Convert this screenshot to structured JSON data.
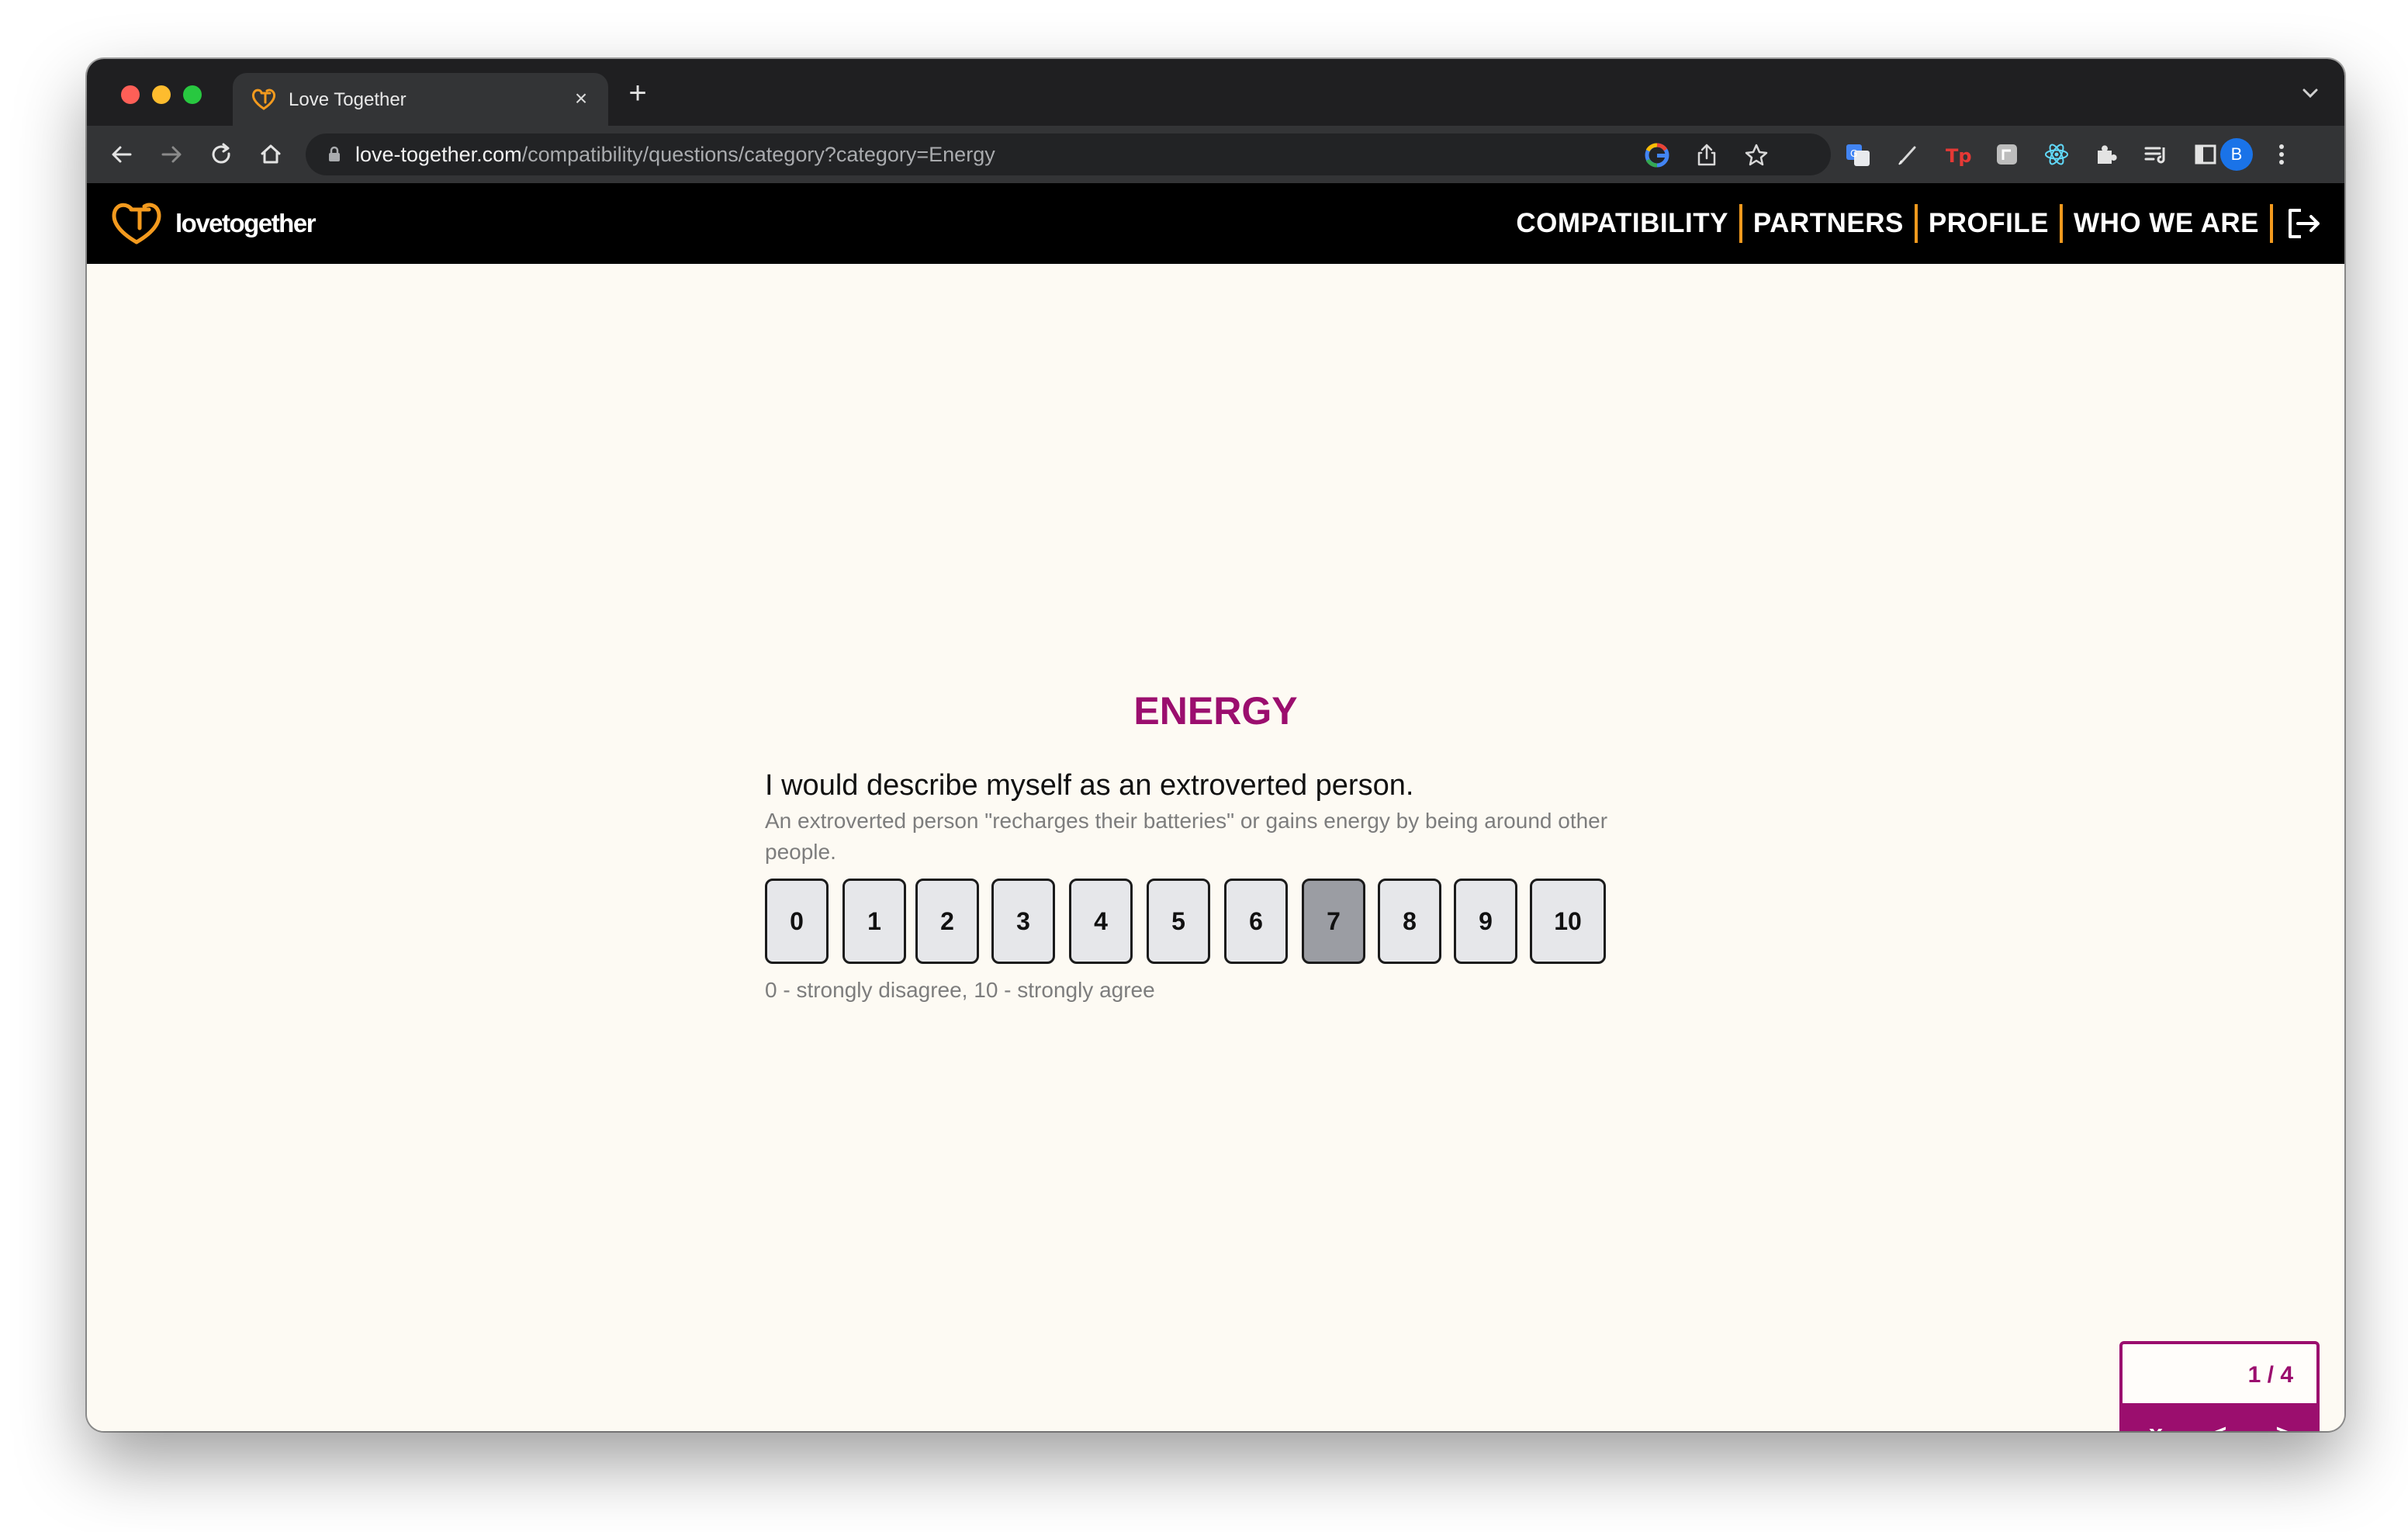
{
  "browser": {
    "tab_title": "Love Together",
    "tab_close": "×",
    "new_tab": "+",
    "url_host": "love-together.com",
    "url_path": "/compatibility/questions/category?category=Energy",
    "profile_initial": "B"
  },
  "site": {
    "logo_text": "lovetogether",
    "brand_color": "#9b0e6e",
    "accent_color": "#f39a1e",
    "nav": {
      "compatibility": "COMPATIBILITY",
      "partners": "PARTNERS",
      "profile": "PROFILE",
      "who_we_are": "WHO WE ARE"
    }
  },
  "question": {
    "category": "ENERGY",
    "text": "I would describe myself as an extroverted person.",
    "description": "An extroverted person \"recharges their batteries\" or gains energy by being around other people.",
    "scale": [
      "0",
      "1",
      "2",
      "3",
      "4",
      "5",
      "6",
      "7",
      "8",
      "9",
      "10"
    ],
    "selected_value": "7",
    "scale_hint": "0 - strongly disagree, 10 - strongly agree"
  },
  "pager": {
    "count": "1 / 4",
    "close_label": "x",
    "prev_label": "<",
    "next_label": ">"
  }
}
